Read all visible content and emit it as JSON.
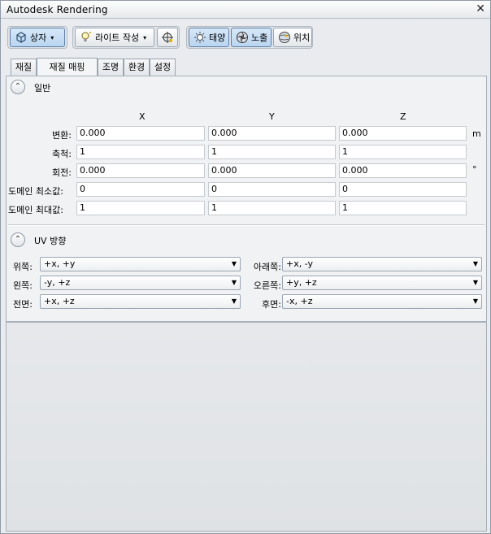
{
  "window": {
    "title": "Autodesk Rendering",
    "close": "✕"
  },
  "toolbar": {
    "box_label": "상자",
    "light_label": "라이트 작성",
    "sun_label": "태양",
    "exposure_label": "노출",
    "location_label": "위치",
    "caret": "▾"
  },
  "tabs": [
    "재질",
    "재질 매핑",
    "조명",
    "환경",
    "설정"
  ],
  "active_tab": "재질 매핑",
  "general": {
    "header": "일반",
    "collapse_glyph": "⌃",
    "col_x": "X",
    "col_y": "Y",
    "col_z": "Z",
    "rows": [
      {
        "label": "변환:",
        "x": "0.000",
        "y": "0.000",
        "z": "0.000",
        "unit": "m"
      },
      {
        "label": "축척:",
        "x": "1",
        "y": "1",
        "z": "1",
        "unit": ""
      },
      {
        "label": "회전:",
        "x": "0.000",
        "y": "0.000",
        "z": "0.000",
        "unit": "°"
      },
      {
        "label": "도메인 최소값:",
        "x": "0",
        "y": "0",
        "z": "0",
        "unit": ""
      },
      {
        "label": "도메인 최대값:",
        "x": "1",
        "y": "1",
        "z": "1",
        "unit": ""
      }
    ]
  },
  "uv": {
    "header": "UV 방향",
    "collapse_glyph": "⌃",
    "left": [
      {
        "label": "위쪽:",
        "value": "+x, +y"
      },
      {
        "label": "왼쪽:",
        "value": "-y, +z"
      },
      {
        "label": "전면:",
        "value": "+x, +z"
      }
    ],
    "right": [
      {
        "label": "아래쪽:",
        "value": "+x, -y"
      },
      {
        "label": "오른쪽:",
        "value": "+y, +z"
      },
      {
        "label": "후면:",
        "value": "-x, +z"
      }
    ],
    "arrow": "▼"
  },
  "colors": {
    "accent": "#5d7fa6",
    "active_btn": "#c4dcf3"
  }
}
